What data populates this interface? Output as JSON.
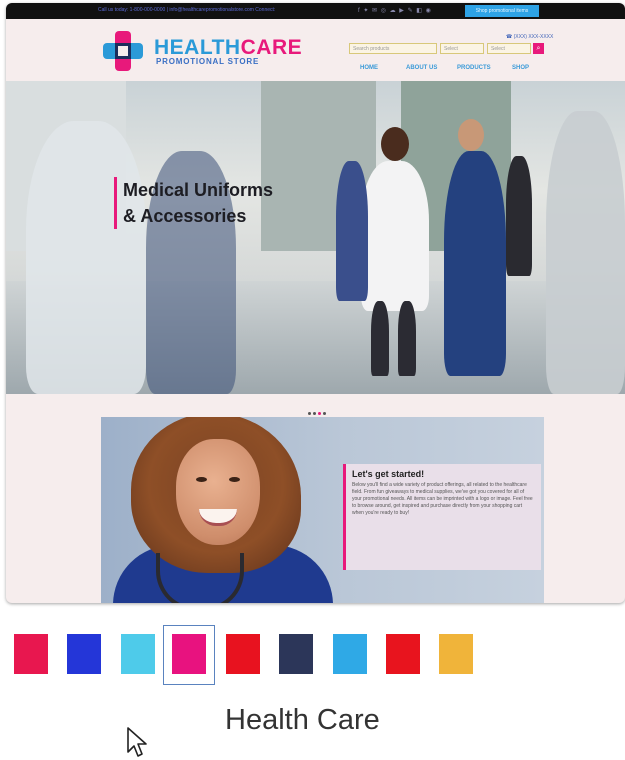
{
  "site": {
    "topbar": {
      "info": "Call us today: 1-800-000-0000 | info@healthcarepromotionalstore.com   Connect:",
      "social": "f ✦ ✉ ◎ ☁ ▶ ✎ ◧ ◉",
      "cta": "Shop promotional items"
    },
    "brand": {
      "part1": "HEALTH",
      "part2": "CARE",
      "subtitle": "PROMOTIONAL STORE"
    },
    "phone": "☎ (XXX) XXX-XXXX",
    "search": {
      "placeholder": "Search products",
      "field2": "Select",
      "field3": "Select",
      "button": "⌕"
    },
    "nav": [
      "HOME",
      "ABOUT US",
      "PRODUCTS",
      "SHOP"
    ],
    "hero": {
      "line1": "Medical Uniforms",
      "line2": "& Accessories"
    },
    "promo": {
      "title": "Let's get started!",
      "body": "Below you'll find a wide variety of product offerings, all related to the healthcare field. From fun giveaways to medical supplies, we've got you covered for all of your promotional needs. All items can be imprinted with a logo or image. Feel free to browse around, get inspired and purchase directly from your shopping cart when you're ready to buy!"
    }
  },
  "colors": {
    "swatches": [
      "#e8174f",
      "#2436d8",
      "#4ecbea",
      "#e8127f",
      "#e8121f",
      "#2c3659",
      "#2fa9e6",
      "#e8141e",
      "#f0b43a"
    ],
    "selected_index": 3
  },
  "theme_name": "Health Care"
}
